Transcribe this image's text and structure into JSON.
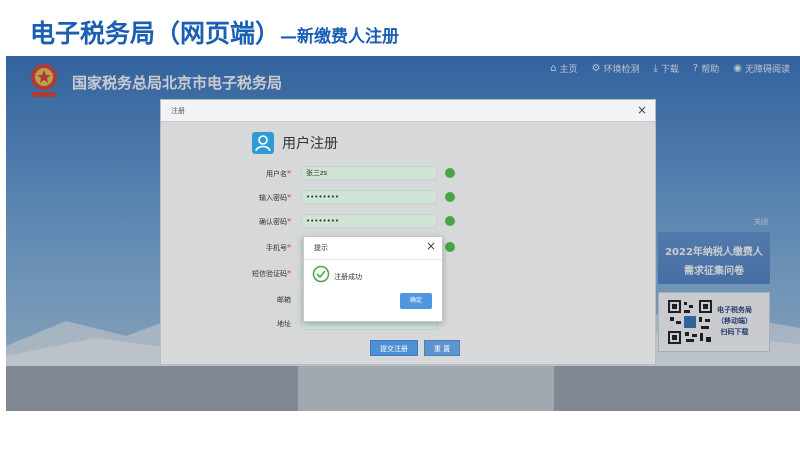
{
  "slide": {
    "title": "电子税务局（网页端）",
    "subtitle": "—新缴费人注册"
  },
  "site": {
    "title": "国家税务总局北京市电子税务局"
  },
  "nav": [
    {
      "label": "主页",
      "icon": "home-icon",
      "glyph": "⌂"
    },
    {
      "label": "环境检测",
      "icon": "wrench-icon",
      "glyph": "⚙"
    },
    {
      "label": "下载",
      "icon": "download-icon",
      "glyph": "⤓"
    },
    {
      "label": "帮助",
      "icon": "help-icon",
      "glyph": "?"
    },
    {
      "label": "无障碍阅读",
      "icon": "eye-icon",
      "glyph": "◉"
    }
  ],
  "promo": {
    "close": "关闭",
    "line1": "2022年纳税人缴费人",
    "line2": "需求征集问卷"
  },
  "qr_card": {
    "line1": "电子税务局",
    "line2": "（移动端）",
    "line3": "扫码下载"
  },
  "register": {
    "dialog_title": "注册",
    "close": "×",
    "heading": "用户注册",
    "fields": [
      {
        "label": "用户名",
        "required": true,
        "value": "张三zs",
        "ok": true
      },
      {
        "label": "输入密码",
        "required": true,
        "value": "••••••••",
        "ok": true
      },
      {
        "label": "确认密码",
        "required": true,
        "value": "••••••••",
        "ok": true
      },
      {
        "label": "手机号",
        "required": true,
        "value": "",
        "ok": true
      },
      {
        "label": "短信验证码",
        "required": true,
        "value": "",
        "ok": false
      },
      {
        "label": "邮箱",
        "required": false,
        "value": "",
        "ok": false
      },
      {
        "label": "地址",
        "required": false,
        "value": "",
        "ok": false
      }
    ],
    "submit": "提交注册",
    "reset": "重 置"
  },
  "tip": {
    "title": "提示",
    "close": "×",
    "message": "注册成功",
    "confirm": "确定"
  },
  "colors": {
    "title_blue": "#1a5fb4",
    "button_blue": "#4f97e0",
    "success_green": "#47a447"
  }
}
